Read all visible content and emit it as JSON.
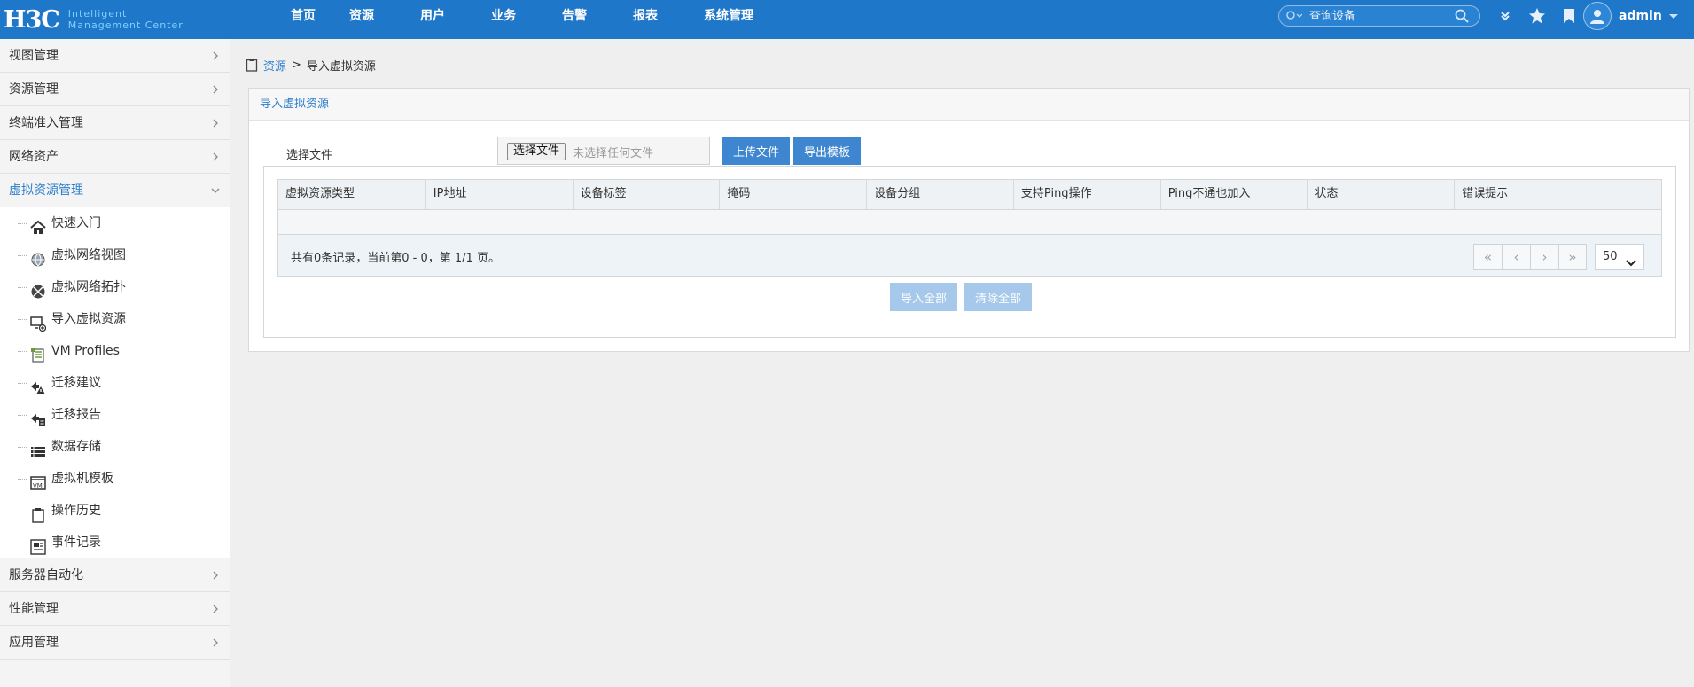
{
  "header": {
    "logo_mark": "H3C",
    "logo_line1": "Intelligent",
    "logo_line2": "Management Center",
    "nav": [
      "首页",
      "资源",
      "用户",
      "业务",
      "告警",
      "报表",
      "系统管理"
    ],
    "search_placeholder": "查询设备",
    "user_name": "admin"
  },
  "sidebar": {
    "groups_top": [
      "视图管理",
      "资源管理",
      "终端准入管理",
      "网络资产"
    ],
    "active_group": "虚拟资源管理",
    "sub_items": [
      {
        "label": "快速入门",
        "icon": "home-icon"
      },
      {
        "label": "虚拟网络视图",
        "icon": "globe-icon"
      },
      {
        "label": "虚拟网络拓扑",
        "icon": "topology-icon"
      },
      {
        "label": "导入虚拟资源",
        "icon": "import-monitor-icon"
      },
      {
        "label": "VM Profiles",
        "icon": "vm-profile-icon"
      },
      {
        "label": "迁移建议",
        "icon": "migration-advice-icon"
      },
      {
        "label": "迁移报告",
        "icon": "migration-report-icon"
      },
      {
        "label": "数据存储",
        "icon": "datastore-icon"
      },
      {
        "label": "虚拟机模板",
        "icon": "vm-template-icon"
      },
      {
        "label": "操作历史",
        "icon": "clipboard-icon"
      },
      {
        "label": "事件记录",
        "icon": "event-log-icon"
      }
    ],
    "groups_bottom": [
      "服务器自动化",
      "性能管理",
      "应用管理"
    ]
  },
  "breadcrumb": {
    "root": "资源",
    "separator": ">",
    "current": "导入虚拟资源"
  },
  "panel": {
    "title": "导入虚拟资源",
    "file_label": "选择文件",
    "file_button": "选择文件",
    "file_status": "未选择任何文件",
    "upload_button": "上传文件",
    "export_button": "导出模板",
    "columns": [
      "虚拟资源类型",
      "IP地址",
      "设备标签",
      "掩码",
      "设备分组",
      "支持Ping操作",
      "Ping不通也加入",
      "状态",
      "错误提示"
    ],
    "pager_info": "共有0条记录，当前第0 - 0，第 1/1 页。",
    "page_size": "50",
    "import_all": "导入全部",
    "clear_all": "清除全部"
  },
  "colors": {
    "header_bg": "#1f77c9",
    "accent": "#2d7fc9",
    "button_blue": "#3e86cf",
    "button_disabled": "#a6c8ea"
  }
}
